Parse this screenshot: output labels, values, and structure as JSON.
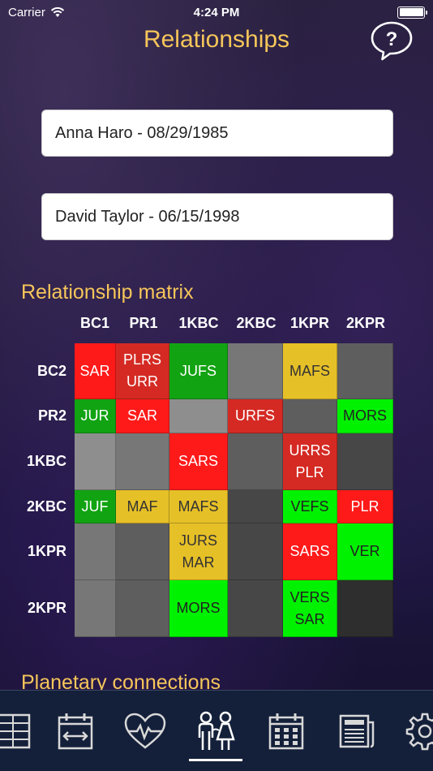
{
  "status_bar": {
    "carrier": "Carrier",
    "time": "4:24 PM",
    "battery_level": 1.0
  },
  "header": {
    "title": "Relationships",
    "help_icon": "question-bubble-icon"
  },
  "person1": {
    "value": "Anna Haro - 08/29/1985"
  },
  "person2": {
    "value": "David Taylor - 06/15/1998"
  },
  "matrix": {
    "title": "Relationship matrix",
    "columns": [
      "BC1",
      "PR1",
      "1KBC",
      "2KBC",
      "1KPR",
      "2KPR"
    ],
    "rows": [
      {
        "label": "BC2",
        "cells": [
          {
            "text": [
              "SAR"
            ],
            "color": "red"
          },
          {
            "text": [
              "PLRS",
              "URR"
            ],
            "color": "dred"
          },
          {
            "text": [
              "JUFS"
            ],
            "color": "dgreen"
          },
          {
            "text": [],
            "color": "g2"
          },
          {
            "text": [
              "MAFS"
            ],
            "color": "yellow"
          },
          {
            "text": [],
            "color": "g3"
          }
        ]
      },
      {
        "label": "PR2",
        "cells": [
          {
            "text": [
              "JUR"
            ],
            "color": "dgreen"
          },
          {
            "text": [
              "SAR"
            ],
            "color": "red"
          },
          {
            "text": [],
            "color": "g1"
          },
          {
            "text": [
              "URFS"
            ],
            "color": "dred"
          },
          {
            "text": [],
            "color": "g3"
          },
          {
            "text": [
              "MORS"
            ],
            "color": "green"
          }
        ]
      },
      {
        "label": "1KBC",
        "cells": [
          {
            "text": [],
            "color": "g1"
          },
          {
            "text": [],
            "color": "g2"
          },
          {
            "text": [
              "SARS"
            ],
            "color": "red"
          },
          {
            "text": [],
            "color": "g3"
          },
          {
            "text": [
              "URRS",
              "PLR"
            ],
            "color": "dred"
          },
          {
            "text": [],
            "color": "g4"
          }
        ]
      },
      {
        "label": "2KBC",
        "cells": [
          {
            "text": [
              "JUF"
            ],
            "color": "dgreen"
          },
          {
            "text": [
              "MAF"
            ],
            "color": "yellow"
          },
          {
            "text": [
              "MAFS"
            ],
            "color": "yellow"
          },
          {
            "text": [],
            "color": "g4"
          },
          {
            "text": [
              "VEFS"
            ],
            "color": "green"
          },
          {
            "text": [
              "PLR"
            ],
            "color": "red"
          }
        ]
      },
      {
        "label": "1KPR",
        "cells": [
          {
            "text": [],
            "color": "g2"
          },
          {
            "text": [],
            "color": "g3"
          },
          {
            "text": [
              "JURS",
              "MAR"
            ],
            "color": "yellow"
          },
          {
            "text": [],
            "color": "g4"
          },
          {
            "text": [
              "SARS"
            ],
            "color": "red"
          },
          {
            "text": [
              "VER"
            ],
            "color": "green"
          }
        ]
      },
      {
        "label": "2KPR",
        "cells": [
          {
            "text": [],
            "color": "g2"
          },
          {
            "text": [],
            "color": "g3"
          },
          {
            "text": [
              "MORS"
            ],
            "color": "green"
          },
          {
            "text": [],
            "color": "g4"
          },
          {
            "text": [
              "VERS",
              "SAR"
            ],
            "color": "green"
          },
          {
            "text": [],
            "color": "g5"
          }
        ]
      }
    ]
  },
  "planetary": {
    "title": "Planetary connections"
  },
  "tab_bar": {
    "tabs": [
      {
        "name": "table-icon"
      },
      {
        "name": "calendar-range-icon"
      },
      {
        "name": "heartbeat-icon"
      },
      {
        "name": "couple-icon",
        "selected": true
      },
      {
        "name": "calendar-grid-icon"
      },
      {
        "name": "newspaper-icon"
      },
      {
        "name": "gear-icon"
      }
    ]
  }
}
